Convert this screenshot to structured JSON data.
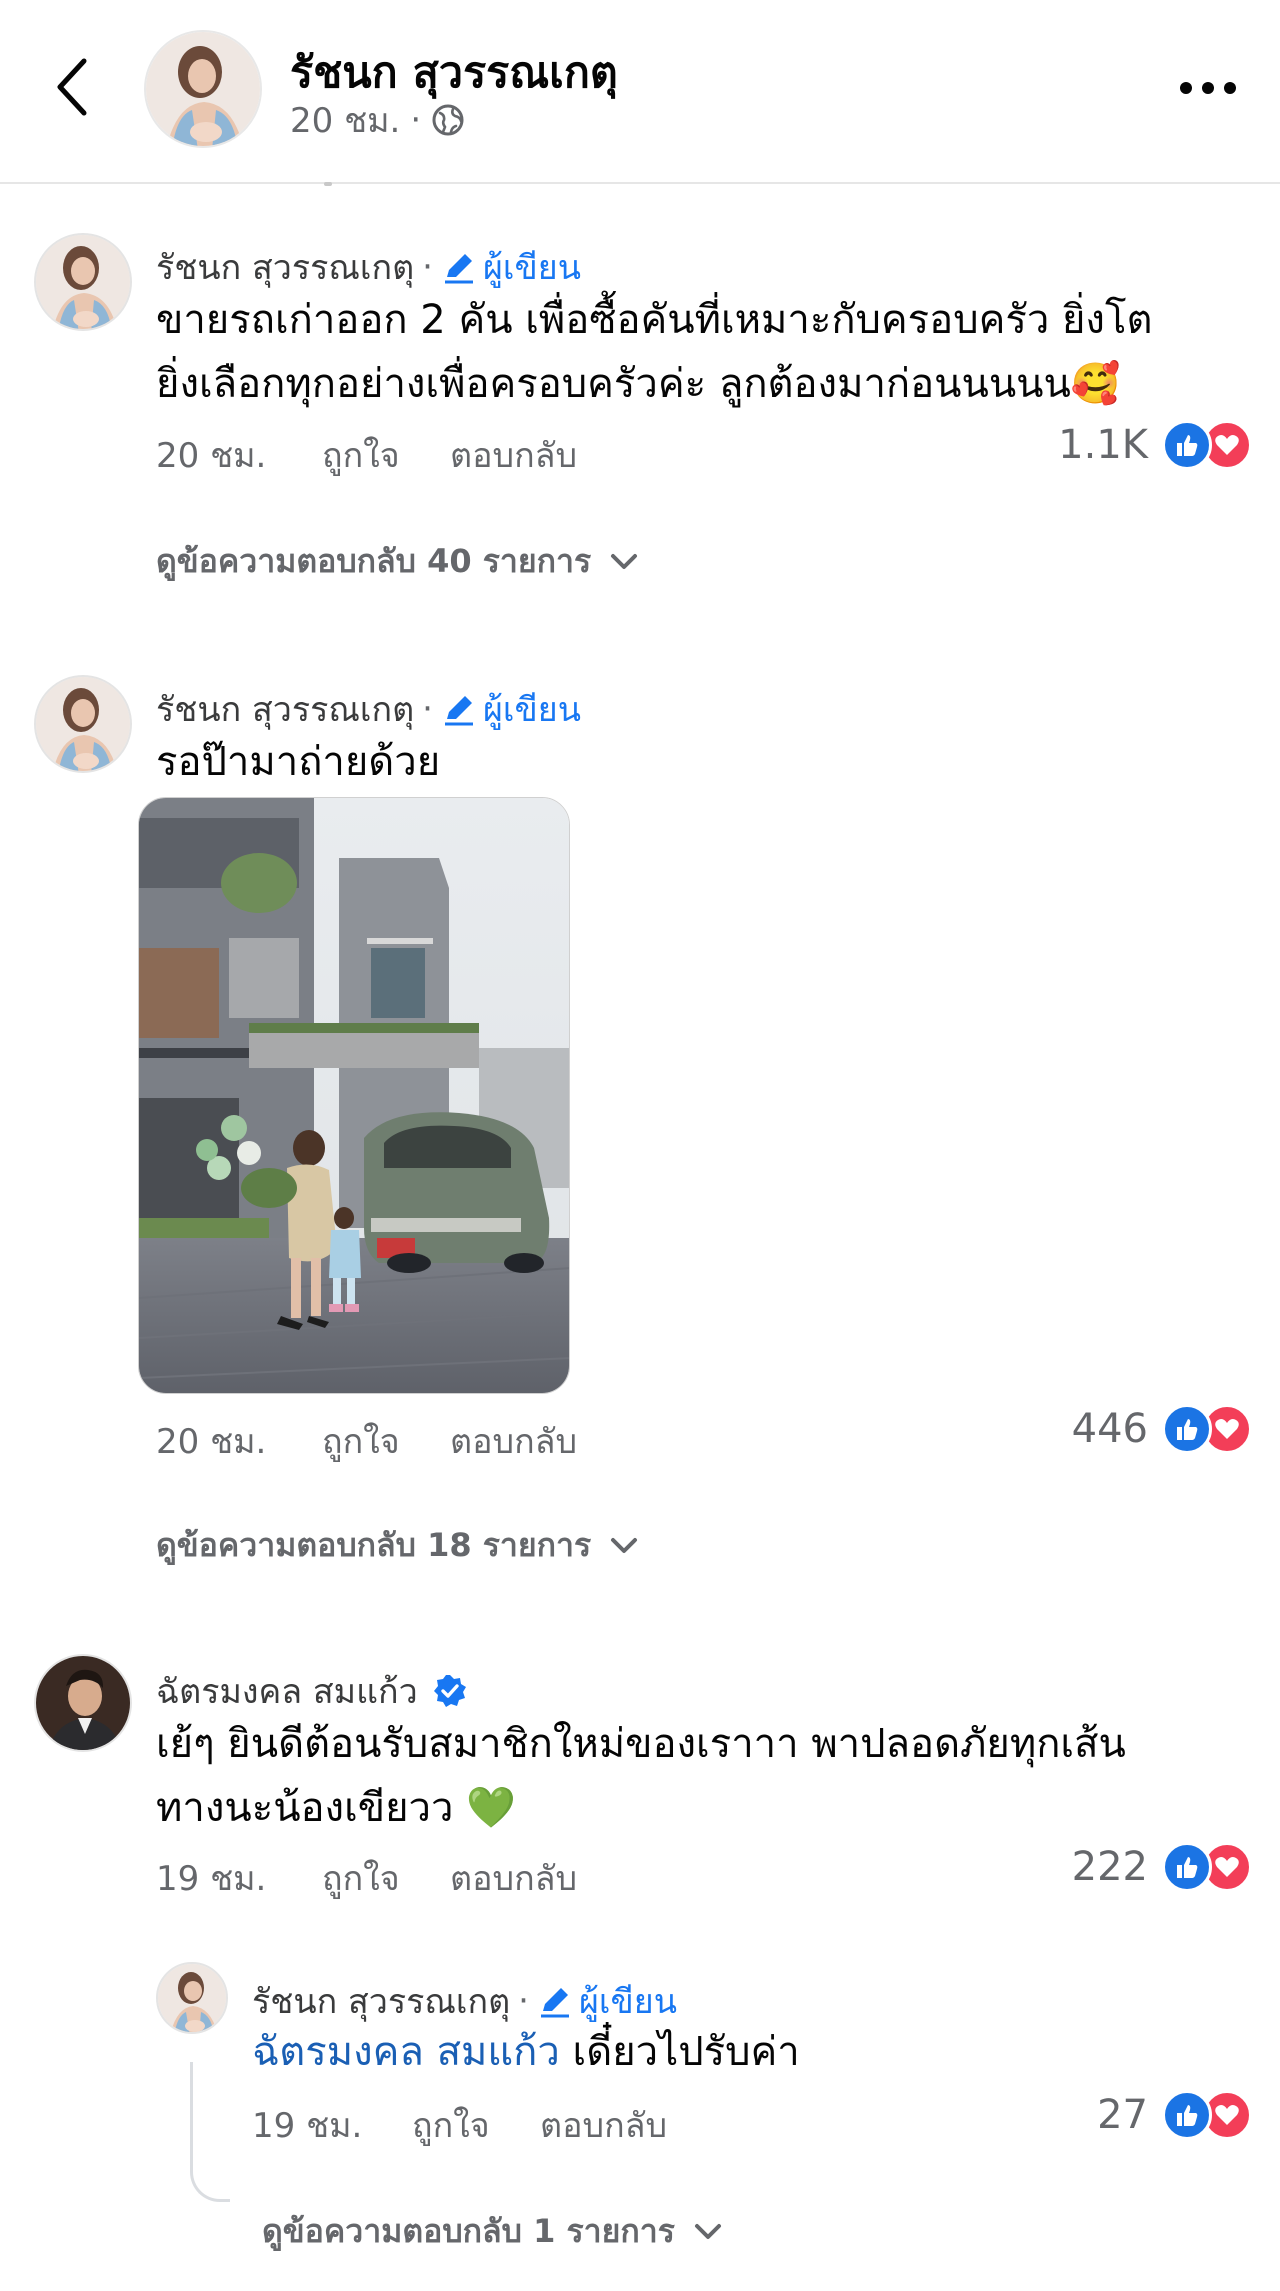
{
  "header": {
    "title": "รัชนก สุวรรณเกตุ",
    "time": "20 ชม.",
    "separator": "·",
    "privacy_icon": "globe-icon",
    "back_icon": "chevron-left-icon",
    "more_icon": "more-dots-icon"
  },
  "labels": {
    "like": "ถูกใจ",
    "reply": "ตอบกลับ",
    "author_badge": "ผู้เขียน",
    "separator": "·"
  },
  "comments": [
    {
      "name": "รัชนก สุวรรณเกตุ",
      "is_author": true,
      "line1": "ขายรถเก่าออก 2 คัน เพื่อซื้อคันที่เหมาะกับครอบครัว ยิ่งโต",
      "line2": "ยิ่งเลือกทุกอย่างเพื่อครอบครัวค่ะ ลูกต้องมาก่อนนนนน🥰",
      "time": "20 ชม.",
      "reactions": "1.1K",
      "view_replies": "ดูข้อความตอบกลับ 40 รายการ"
    },
    {
      "name": "รัชนก สุวรรณเกตุ",
      "is_author": true,
      "line1": "รอป๊ามาถ่ายด้วย",
      "has_photo": true,
      "time": "20 ชม.",
      "reactions": "446",
      "view_replies": "ดูข้อความตอบกลับ 18 รายการ"
    },
    {
      "name": "ฉัตรมงคล สมแก้ว",
      "verified": true,
      "line1": "เย้ๆ ยินดีต้อนรับสมาชิกใหม่ของเราาา  พาปลอดภัยทุกเส้น",
      "line2": "ทางนะน้องเขียวว 💚",
      "time": "19 ชม.",
      "reactions": "222"
    }
  ],
  "reply": {
    "name": "รัชนก สุวรรณเกตุ",
    "is_author": true,
    "mention": "ฉัตรมงคล สมแก้ว",
    "text": " เดี๋ยวไปรับค่า",
    "time": "19 ชม.",
    "reactions": "27",
    "view_replies": "ดูข้อความตอบกลับ 1 รายการ"
  },
  "colors": {
    "accent": "#1877f2",
    "like": "#1b74e4",
    "love": "#f33e58",
    "verified": "#1877f2"
  }
}
